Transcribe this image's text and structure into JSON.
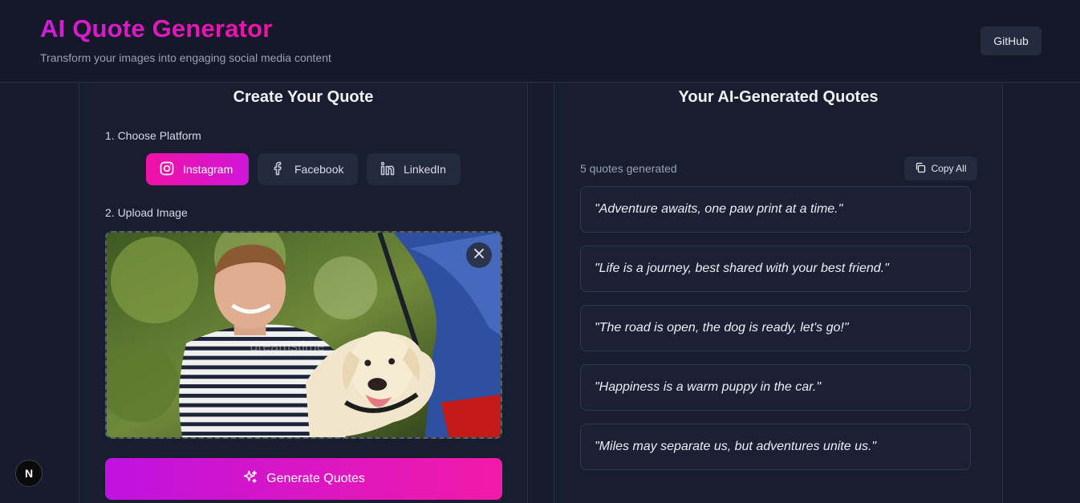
{
  "header": {
    "title": "AI Quote Generator",
    "subtitle": "Transform your images into engaging social media content",
    "github_label": "GitHub"
  },
  "create_panel": {
    "title": "Create Your Quote",
    "step1_label": "1. Choose Platform",
    "platforms": [
      {
        "label": "Instagram",
        "icon": "instagram-icon",
        "selected": true
      },
      {
        "label": "Facebook",
        "icon": "facebook-icon",
        "selected": false
      },
      {
        "label": "LinkedIn",
        "icon": "linkedin-icon",
        "selected": false
      }
    ],
    "step2_label": "2. Upload Image",
    "image_watermark": "dreamstime",
    "generate_label": "Generate Quotes"
  },
  "quotes_panel": {
    "title": "Your AI-Generated Quotes",
    "count_text": "5 quotes generated",
    "copy_all_label": "Copy All",
    "quotes": [
      "\"Adventure awaits, one paw print at a time.\"",
      "\"Life is a journey, best shared with your best friend.\"",
      "\"The road is open, the dog is ready, let's go!\"",
      "\"Happiness is a warm puppy in the car.\"",
      "\"Miles may separate us, but adventures unite us.\""
    ]
  },
  "badge": {
    "label": "N"
  },
  "colors": {
    "accent_pink": "#f012a6",
    "accent_purple": "#c012e0",
    "background": "#161b2e"
  }
}
